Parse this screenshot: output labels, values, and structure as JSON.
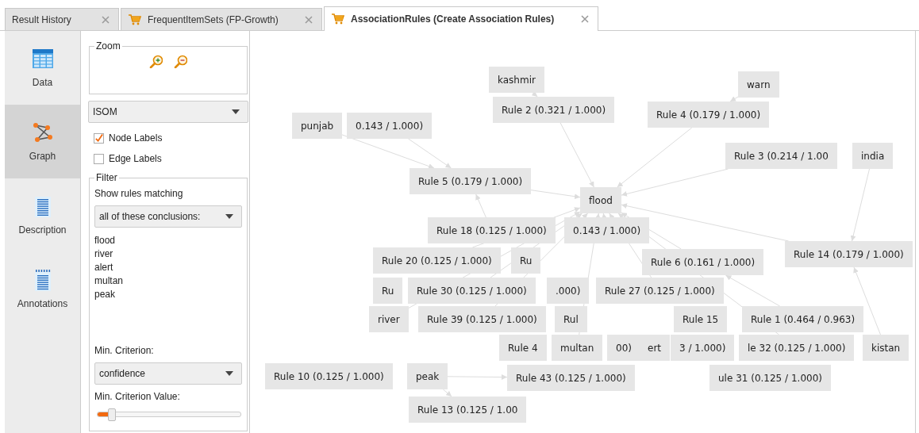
{
  "tabs": [
    {
      "label": "Result History",
      "kind": "history",
      "selected": false
    },
    {
      "label": "FrequentItemSets (FP-Growth)",
      "kind": "result",
      "selected": false
    },
    {
      "label": "AssociationRules (Create Association Rules)",
      "kind": "result",
      "selected": true
    }
  ],
  "sidebar": {
    "items": [
      {
        "label": "Data",
        "kind": "data",
        "selected": false
      },
      {
        "label": "Graph",
        "kind": "graph",
        "selected": true
      },
      {
        "label": "Description",
        "kind": "description",
        "selected": false
      },
      {
        "label": "Annotations",
        "kind": "annotations",
        "selected": false
      }
    ]
  },
  "settings": {
    "zoom": {
      "title": "Zoom"
    },
    "layout": {
      "value": "ISOM"
    },
    "checkboxes": [
      {
        "label": "Node Labels",
        "checked": true
      },
      {
        "label": "Edge Labels",
        "checked": false
      }
    ],
    "filter": {
      "title": "Filter",
      "label": "Show rules matching",
      "mode": "all of these conclusions:",
      "items": [
        "flood",
        "river",
        "alert",
        "multan",
        "peak"
      ],
      "criterion_label": "Min. Criterion:",
      "criterion": "confidence",
      "value_label": "Min. Criterion Value:",
      "slider": {
        "level": 0.1
      }
    }
  },
  "graph": {
    "nodes": [
      {
        "label": "kashmir"
      },
      {
        "label": "warn"
      },
      {
        "label": "Rule 2 (0.321 / 1.000)"
      },
      {
        "label": "Rule 4 (0.179 / 1.000)"
      },
      {
        "label": "punjab"
      },
      {
        "label": "0.143 / 1.000)"
      },
      {
        "label": "Rule 3 (0.214 / 1.00"
      },
      {
        "label": "india"
      },
      {
        "label": "Rule 5 (0.179 / 1.000)"
      },
      {
        "label": "flood"
      },
      {
        "label": "Rule 18 (0.125 / 1.000)"
      },
      {
        "label": "0.143 / 1.000)"
      },
      {
        "label": "Rule 14 (0.179 / 1.000)"
      },
      {
        "label": "Rule 20 (0.125 / 1.000)"
      },
      {
        "label": "Ru"
      },
      {
        "label": "Rule 6 (0.161 / 1.000)"
      },
      {
        "label": "Ru"
      },
      {
        "label": "Rule 30 (0.125 / 1.000)"
      },
      {
        "label": ".000)"
      },
      {
        "label": "Rule 27 (0.125 / 1.000)"
      },
      {
        "label": "river"
      },
      {
        "label": "Rule 39 (0.125 / 1.000)"
      },
      {
        "label": "Rul"
      },
      {
        "label": "Rule 15"
      },
      {
        "label": "Rule 1 (0.464 / 0.963)"
      },
      {
        "label": "Rule 4"
      },
      {
        "label": "multan"
      },
      {
        "label": "00)"
      },
      {
        "label": "ert"
      },
      {
        "label": "3 / 1.000)"
      },
      {
        "label": "le 32 (0.125 / 1.000)"
      },
      {
        "label": "kistan"
      },
      {
        "label": "Rule 10 (0.125 / 1.000)"
      },
      {
        "label": "peak"
      },
      {
        "label": "Rule 43 (0.125 / 1.000)"
      },
      {
        "label": "ule 31 (0.125 / 1.000)"
      },
      {
        "label": "Rule 13 (0.125 / 1.00"
      }
    ]
  }
}
